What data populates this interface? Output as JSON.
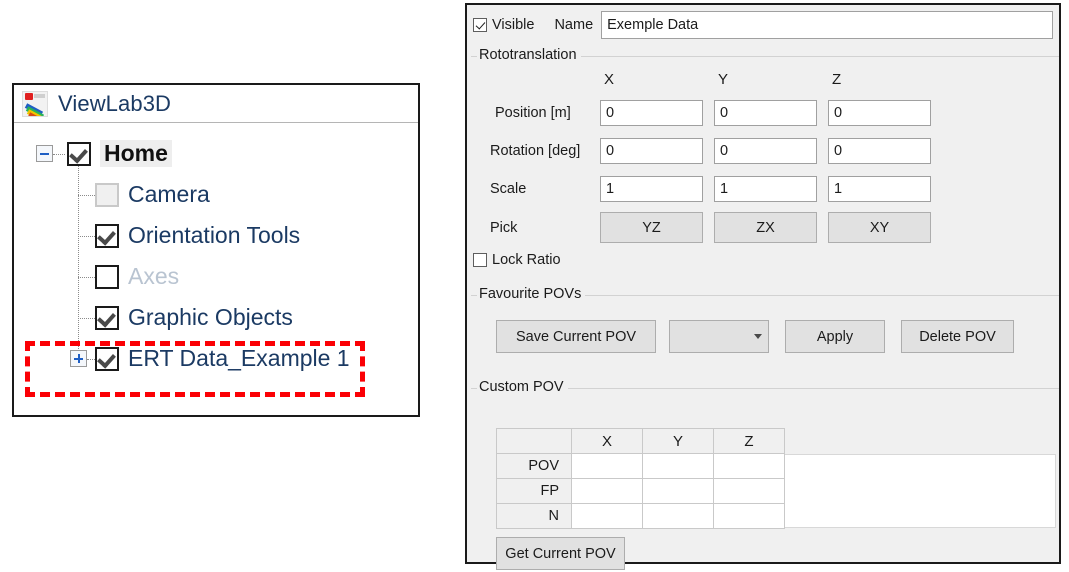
{
  "tree_panel": {
    "app_title": "ViewLab3D",
    "logo_icon": "viewlab3d-app-icon",
    "items": [
      {
        "label": "Home",
        "checked": true,
        "disabled": false,
        "bold": true,
        "indent": 0,
        "expander": "minus"
      },
      {
        "label": "Camera",
        "checked": false,
        "disabled": true,
        "bold": false,
        "indent": 1,
        "expander": "none"
      },
      {
        "label": "Orientation Tools",
        "checked": true,
        "disabled": false,
        "bold": false,
        "indent": 1,
        "expander": "none"
      },
      {
        "label": "Axes",
        "checked": false,
        "disabled": false,
        "bold": false,
        "indent": 1,
        "expander": "none",
        "muted": true
      },
      {
        "label": "Graphic Objects",
        "checked": true,
        "disabled": false,
        "bold": false,
        "indent": 1,
        "expander": "none"
      },
      {
        "label": "ERT Data_Example 1",
        "checked": true,
        "disabled": false,
        "bold": false,
        "indent": 1,
        "expander": "plus"
      }
    ],
    "highlight_color": "#fb0005"
  },
  "properties_panel": {
    "visible_label": "Visible",
    "visible_checked": true,
    "name_label": "Name",
    "name_value": "Exemple Data",
    "name_placeholder": "",
    "rototranslation": {
      "title": "Rototranslation",
      "axis_headers": [
        "X",
        "Y",
        "Z"
      ],
      "rows": [
        {
          "label": "Position [m]",
          "values": [
            "0",
            "0",
            "0"
          ]
        },
        {
          "label": "Rotation [deg]",
          "values": [
            "0",
            "0",
            "0"
          ]
        },
        {
          "label": "Scale",
          "values": [
            "1",
            "1",
            "1"
          ]
        }
      ],
      "pick_label": "Pick",
      "pick_buttons": [
        "YZ",
        "ZX",
        "XY"
      ],
      "lock_ratio_label": "Lock Ratio",
      "lock_ratio_checked": false
    },
    "favourite_povs": {
      "title": "Favourite POVs",
      "save_button": "Save Current POV",
      "combo_value": "",
      "combo_icon": "chevron-down-icon",
      "apply_button": "Apply",
      "delete_button": "Delete POV"
    },
    "custom_pov": {
      "title": "Custom POV",
      "columns": [
        "",
        "X",
        "Y",
        "Z"
      ],
      "rows": [
        {
          "label": "POV",
          "values": [
            "",
            "",
            ""
          ]
        },
        {
          "label": "FP",
          "values": [
            "",
            "",
            ""
          ]
        },
        {
          "label": "N",
          "values": [
            "",
            "",
            ""
          ]
        }
      ],
      "get_button": "Get Current POV"
    }
  }
}
